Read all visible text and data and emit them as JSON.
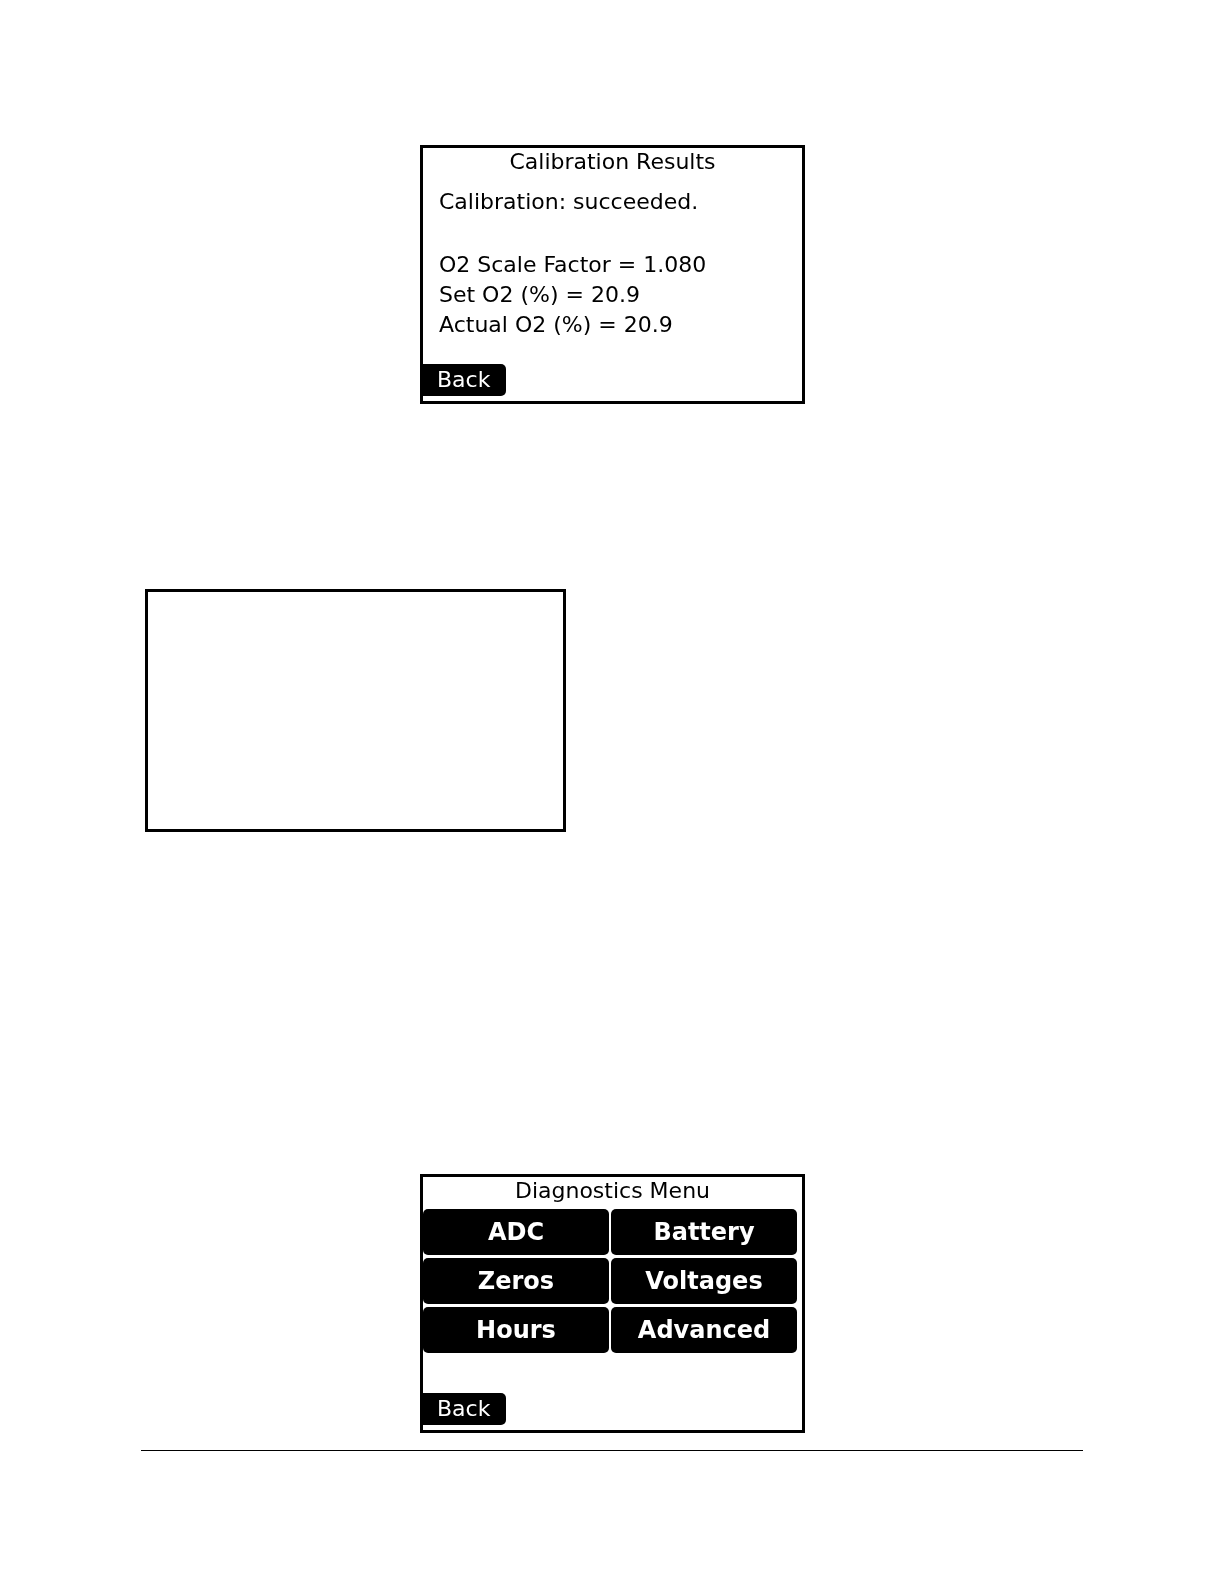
{
  "calibration_screen": {
    "title": "Calibration Results",
    "status": "Calibration: succeeded.",
    "readings": [
      "O2 Scale Factor = 1.080",
      "Set O2 (%) = 20.9",
      "Actual O2 (%) = 20.9"
    ],
    "back_button": "Back"
  },
  "diagnostics_screen": {
    "title": "Diagnostics Menu",
    "menu_buttons": [
      "ADC",
      "Battery",
      "Zeros",
      "Voltages",
      "Hours",
      "Advanced"
    ],
    "back_button": "Back"
  }
}
